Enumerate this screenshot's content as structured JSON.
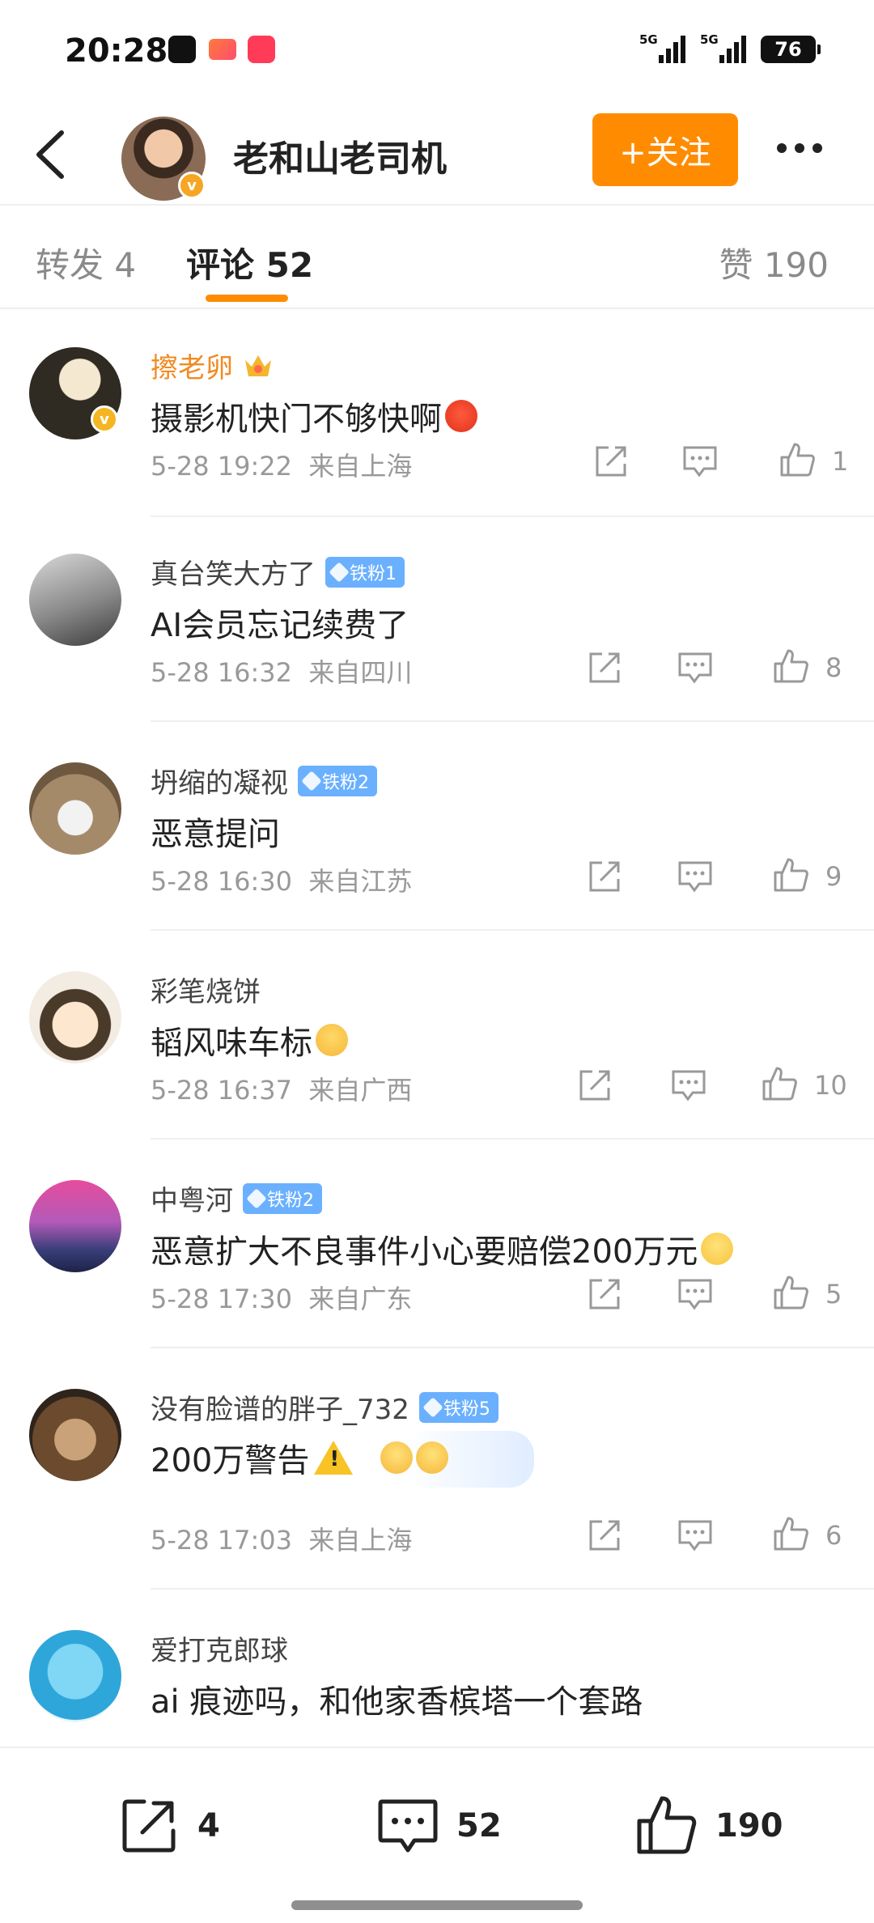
{
  "status_bar": {
    "time": "20:28",
    "network_1": "5G",
    "network_2": "5G",
    "battery": "76"
  },
  "header": {
    "username": "老和山老司机",
    "follow_label": "+关注",
    "verified_badge": "v"
  },
  "tabs": {
    "repost": "转发 4",
    "comments": "评论 52",
    "likes": "赞 190"
  },
  "comments": [
    {
      "user": "擦老卵",
      "badge": "",
      "text": "摄影机快门不够快啊",
      "time": "5-28 19:22",
      "location": "来自上海",
      "likes": "1",
      "vip": true,
      "verified": true
    },
    {
      "user": "真台笑大方了",
      "badge": "铁粉1",
      "text": "AI会员忘记续费了",
      "time": "5-28 16:32",
      "location": "来自四川",
      "likes": "8"
    },
    {
      "user": "坍缩的凝视",
      "badge": "铁粉2",
      "text": "恶意提问",
      "time": "5-28 16:30",
      "location": "来自江苏",
      "likes": "9"
    },
    {
      "user": "彩笔烧饼",
      "badge": "",
      "text": "韬风味车标",
      "time": "5-28 16:37",
      "location": "来自广西",
      "likes": "10"
    },
    {
      "user": "中粤河",
      "badge": "铁粉2",
      "text": "恶意扩大不良事件小心要赔偿200万元",
      "time": "5-28 17:30",
      "location": "来自广东",
      "likes": "5"
    },
    {
      "user": "没有脸谱的胖子_732",
      "badge": "铁粉5",
      "text": "200万警告",
      "time": "5-28 17:03",
      "location": "来自上海",
      "likes": "6"
    },
    {
      "user": "爱打克郎球",
      "badge": "",
      "text": "ai 痕迹吗，和他家香槟塔一个套路",
      "time": "",
      "location": "",
      "likes": ""
    }
  ],
  "bottom_bar": {
    "repost_count": "4",
    "comment_count": "52",
    "like_count": "190"
  },
  "colors": {
    "accent": "#ff8c00",
    "fan_badge": "#6ab0ff",
    "vip_name": "#f08b23",
    "meta_gray": "#999999"
  }
}
